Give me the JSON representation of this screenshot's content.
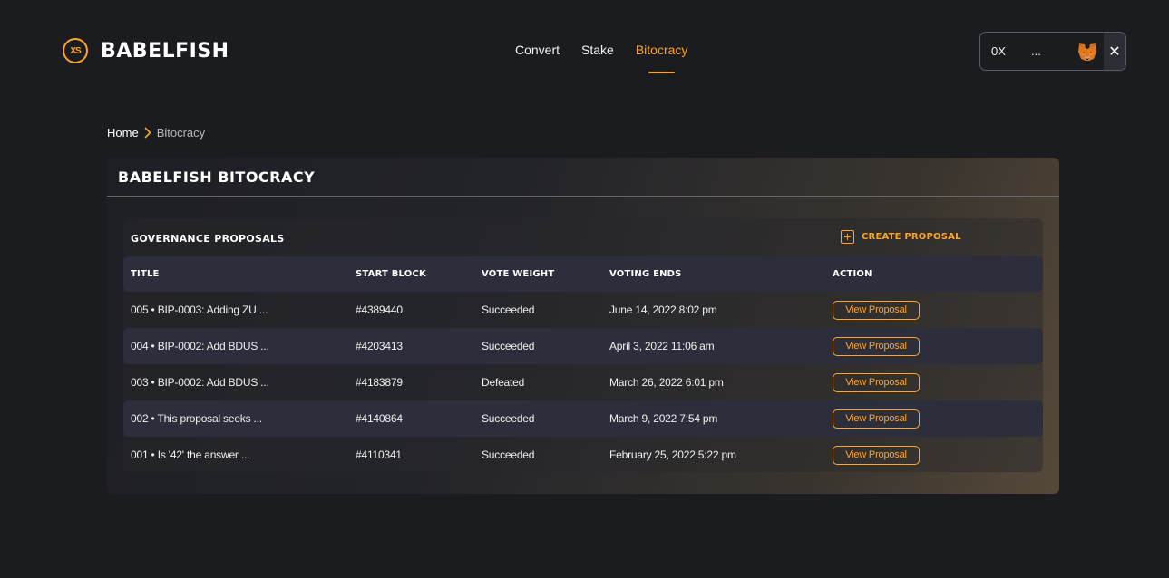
{
  "header": {
    "logo_mark": "XS",
    "logo_text": "BABELFISH",
    "nav": [
      {
        "label": "Convert",
        "active": false
      },
      {
        "label": "Stake",
        "active": false
      },
      {
        "label": "Bitocracy",
        "active": true
      }
    ],
    "wallet": {
      "address": "0X",
      "ellipsis": "...",
      "icon": "metamask-fox-icon",
      "close": "✕"
    }
  },
  "breadcrumb": {
    "home": "Home",
    "separator": "›",
    "current": "Bitocracy"
  },
  "panel": {
    "title": "BABELFISH BITOCRACY",
    "section_label": "GOVERNANCE PROPOSALS",
    "create_label": "CREATE PROPOSAL",
    "columns": [
      "TITLE",
      "START BLOCK",
      "VOTE WEIGHT",
      "VOTING ENDS",
      "ACTION"
    ],
    "rows": [
      {
        "title": "005 • BIP-0003: Adding ZU ...",
        "block": "#4389440",
        "weight": "Succeeded",
        "ends": "June 14, 2022 8:02 pm",
        "action": "View Proposal"
      },
      {
        "title": "004 • BIP-0002: Add BDUS ...",
        "block": "#4203413",
        "weight": "Succeeded",
        "ends": "April 3, 2022 11:06 am",
        "action": "View Proposal"
      },
      {
        "title": "003 • BIP-0002: Add BDUS ...",
        "block": "#4183879",
        "weight": "Defeated",
        "ends": "March 26, 2022 6:01 pm",
        "action": "View Proposal"
      },
      {
        "title": "002 • This proposal seeks ...",
        "block": "#4140864",
        "weight": "Succeeded",
        "ends": "March 9, 2022 7:54 pm",
        "action": "View Proposal"
      },
      {
        "title": "001 • Is '42' the answer ...",
        "block": "#4110341",
        "weight": "Succeeded",
        "ends": "February 25, 2022 5:22 pm",
        "action": "View Proposal"
      }
    ]
  },
  "colors": {
    "accent": "#fea523",
    "background": "#1b1c20",
    "row_alt": "#2c2e3b"
  }
}
